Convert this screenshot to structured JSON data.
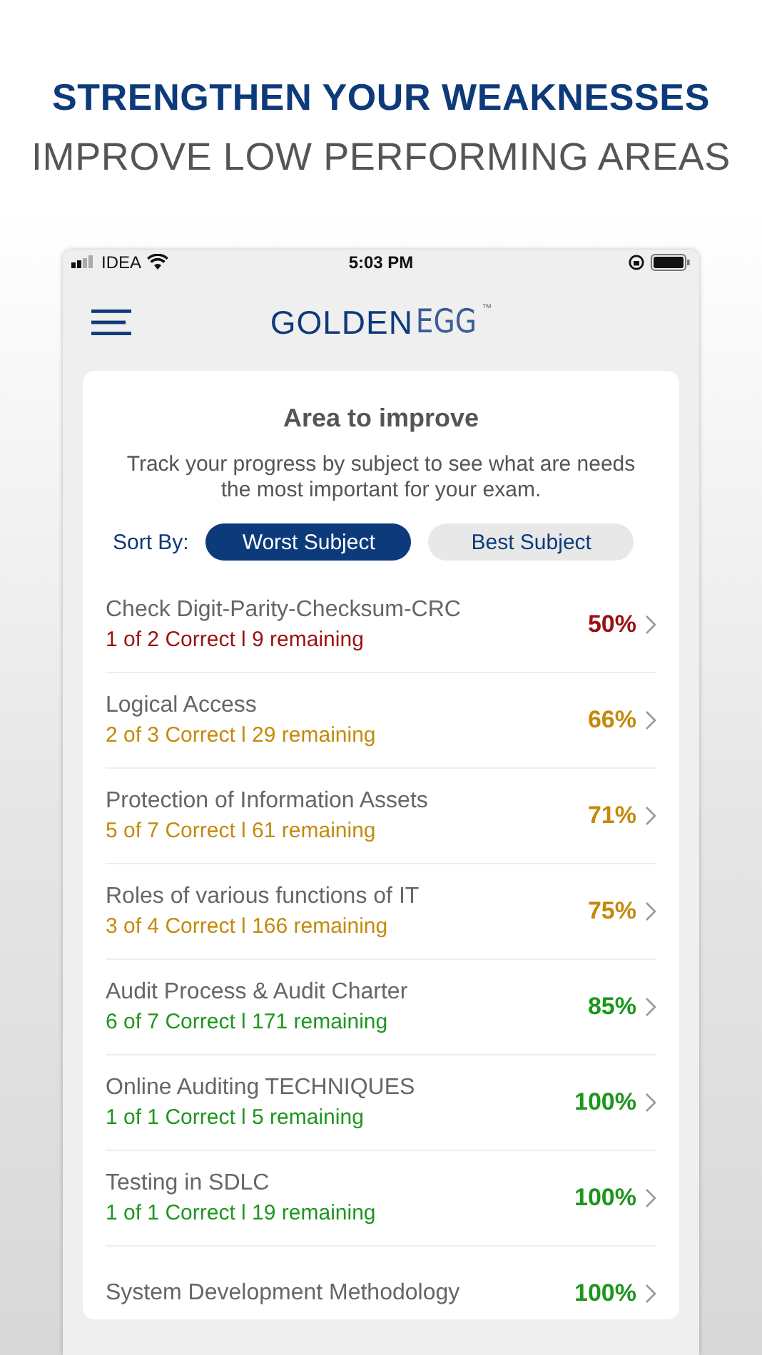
{
  "headline": "STRENGTHEN YOUR WEAKNESSES",
  "subheadline": "IMPROVE LOW PERFORMING AREAS",
  "status_bar": {
    "carrier": "IDEA",
    "time": "5:03 PM"
  },
  "logo": {
    "bold": "GOLDEN",
    "light": "EGG",
    "mark": "™"
  },
  "card": {
    "title": "Area to improve",
    "description": "Track your progress by subject to see what are needs the most important for your exam.",
    "sort_label": "Sort By:",
    "sort_options": [
      {
        "label": "Worst Subject",
        "selected": true
      },
      {
        "label": "Best Subject",
        "selected": false
      }
    ]
  },
  "subjects": [
    {
      "name": "Check Digit-Parity-Checksum-CRC",
      "detail": "1 of 2  Correct l 9 remaining",
      "percent": "50%",
      "color": "#9b1010"
    },
    {
      "name": "Logical Access",
      "detail": "2 of 3  Correct l 29 remaining",
      "percent": "66%",
      "color": "#c48a0c"
    },
    {
      "name": "Protection of Information Assets",
      "detail": "5 of 7  Correct l 61 remaining",
      "percent": "71%",
      "color": "#c48a0c"
    },
    {
      "name": "Roles of various functions of IT",
      "detail": "3 of 4  Correct l 166 remaining",
      "percent": "75%",
      "color": "#c48a0c"
    },
    {
      "name": "Audit Process & Audit Charter",
      "detail": "6 of 7  Correct l 171 remaining",
      "percent": "85%",
      "color": "#1e961e"
    },
    {
      "name": "Online Auditing TECHNIQUES",
      "detail": "1 of 1  Correct l 5 remaining",
      "percent": "100%",
      "color": "#1e961e"
    },
    {
      "name": "Testing in SDLC",
      "detail": "1 of 1  Correct l 19 remaining",
      "percent": "100%",
      "color": "#1e961e"
    },
    {
      "name": "System Development Methodology",
      "percent": "100%",
      "color": "#1e961e"
    }
  ]
}
